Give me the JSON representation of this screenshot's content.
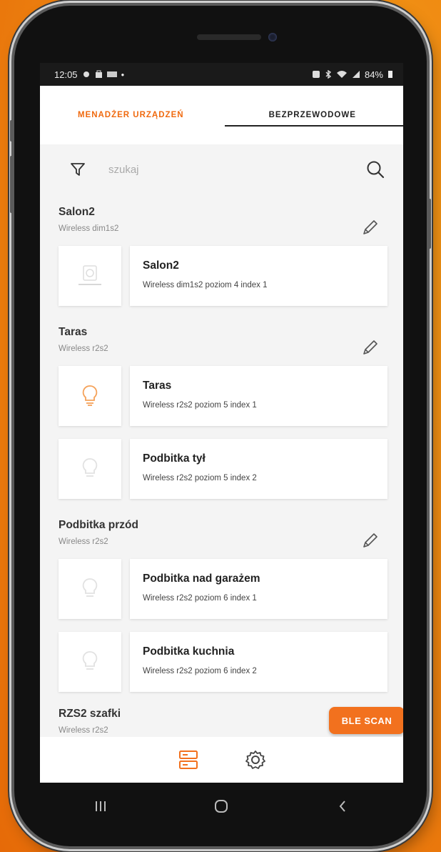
{
  "status_bar": {
    "time": "12:05",
    "battery": "84%"
  },
  "tabs": [
    {
      "label": "MENADŻER URZĄDZEŃ",
      "active": false
    },
    {
      "label": "BEZPRZEWODOWE",
      "active": true
    }
  ],
  "search": {
    "placeholder": "szukaj",
    "value": ""
  },
  "groups": [
    {
      "name": "Salon2",
      "subtitle": "Wireless dim1s2",
      "devices": [
        {
          "name": "Salon2",
          "desc": "Wireless dim1s2 poziom 4 index 1",
          "icon": "dimmer-icon"
        }
      ]
    },
    {
      "name": "Taras",
      "subtitle": "Wireless r2s2",
      "devices": [
        {
          "name": "Taras",
          "desc": "Wireless r2s2 poziom 5 index 1",
          "icon": "bulb-on-icon"
        },
        {
          "name": "Podbitka tył",
          "desc": "Wireless r2s2 poziom 5 index 2",
          "icon": "bulb-off-icon"
        }
      ]
    },
    {
      "name": "Podbitka przód",
      "subtitle": "Wireless r2s2",
      "devices": [
        {
          "name": "Podbitka nad garażem",
          "desc": "Wireless r2s2 poziom 6 index 1",
          "icon": "bulb-off-icon"
        },
        {
          "name": "Podbitka kuchnia",
          "desc": "Wireless r2s2 poziom 6 index 2",
          "icon": "bulb-off-icon"
        }
      ]
    },
    {
      "name": "RZS2 szafki",
      "subtitle": "Wireless r2s2",
      "devices": []
    }
  ],
  "ble_button": {
    "label": "BLE SCAN"
  },
  "colors": {
    "accent": "#f2711e",
    "tab_inactive": "#f06a0f",
    "bulb_on": "#f5a25a",
    "icon_faint": "#dddddd"
  },
  "bottom_nav": [
    {
      "icon": "devices-list-icon",
      "active": true
    },
    {
      "icon": "settings-gear-icon",
      "active": false
    }
  ]
}
